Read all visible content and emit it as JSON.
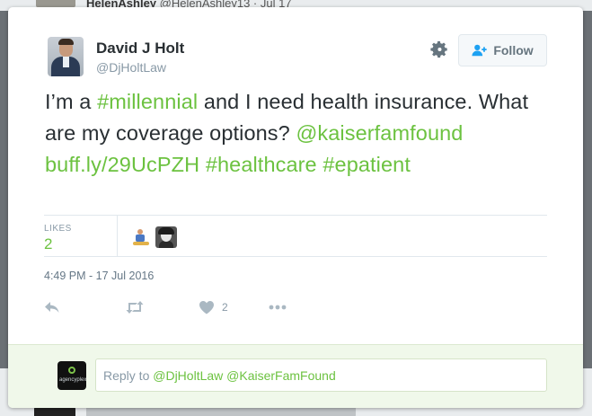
{
  "background": {
    "top_name": "HelenAshley",
    "top_handle": "@HelenAshley13 · Jul 17"
  },
  "tweet": {
    "author_name": "David J Holt",
    "author_handle": "@DjHoltLaw",
    "follow_label": "Follow",
    "text_plain_1": "I’m a ",
    "hashtag_1": "#millennial",
    "text_plain_2": " and I need health insurance. What are my coverage options? ",
    "mention_1": "@kaiserfamfound",
    "link_1": "buff.ly/29UcPZH",
    "hashtag_2": "#healthcare",
    "hashtag_3": "#epatient",
    "likes_label": "LIKES",
    "likes_count": "2",
    "timestamp": "4:49 PM - 17 Jul 2016",
    "like_action_count": "2"
  },
  "reply": {
    "prefix": "Reply to ",
    "mentions": "@DjHoltLaw @KaiserFamFound",
    "avatar_brand": "agencyplex"
  },
  "colors": {
    "accent": "#6cc240",
    "text": "#292f33",
    "muted": "#8899a6",
    "reply_bg": "#f0f8ea"
  },
  "icons": [
    "gear-icon",
    "follow-person-icon",
    "reply-icon",
    "retweet-icon",
    "heart-icon",
    "more-icon"
  ]
}
